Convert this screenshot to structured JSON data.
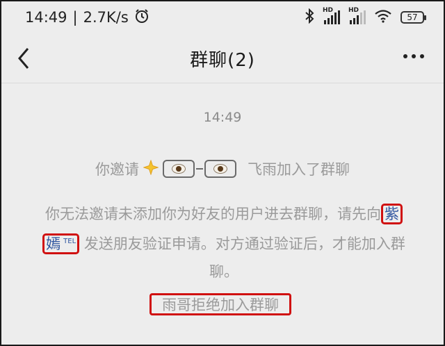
{
  "status_bar": {
    "time": "14:49",
    "separator": "|",
    "network_speed": "2.7K/s",
    "alarm_icon": "alarm-clock-icon",
    "bluetooth_icon": "bluetooth-icon",
    "signal_label_1": "HD",
    "signal_label_2": "HD",
    "wifi_icon": "wifi-icon",
    "battery_level": "57"
  },
  "header": {
    "back_icon": "chevron-left-icon",
    "title": "群聊(2)",
    "more_icon": "more-dots-icon"
  },
  "chat": {
    "timestamp": "14:49",
    "invite_message": {
      "prefix": "你邀请",
      "emoji_icon": "sparkle-star-icon",
      "emoji_glasses": "eyes-glasses-icon",
      "suffix": "飞雨加入了群聊"
    },
    "notice": {
      "part1": "你无法邀请未添加你为好友的用户进去群聊，请先向",
      "name_part1": "紫",
      "name_part2": "嫣",
      "tel_badge": "TEL",
      "part2": "发送朋友验证申请。对方通过验证后，才能加入群聊。"
    },
    "reject_message": "雨哥拒绝加入群聊"
  },
  "colors": {
    "background": "#ededed",
    "system_text": "#9a9a9a",
    "link": "#2f56a0",
    "highlight_box": "#d01010"
  }
}
